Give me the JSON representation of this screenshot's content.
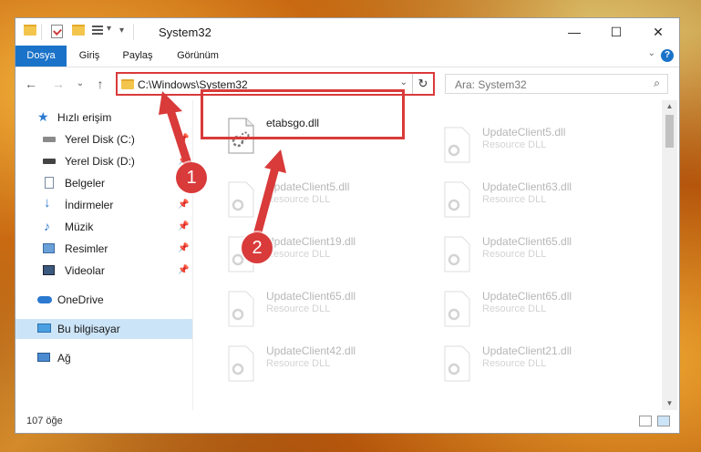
{
  "window": {
    "title": "System32",
    "minimize": "—",
    "maximize": "☐",
    "close": "✕"
  },
  "ribbon": {
    "tabs": [
      "Dosya",
      "Giriş",
      "Paylaş",
      "Görünüm"
    ],
    "help": "?"
  },
  "nav": {
    "back": "←",
    "forward": "→",
    "recent": "⌄",
    "up": "↑",
    "address": "C:\\Windows\\System32",
    "search_placeholder": "Ara: System32"
  },
  "sidebar": {
    "items": [
      {
        "label": "Hızlı erişim",
        "icon": "star-icon",
        "pinned": false
      },
      {
        "label": "Yerel Disk (C:)",
        "icon": "drive-icon",
        "pinned": true
      },
      {
        "label": "Yerel Disk (D:)",
        "icon": "drive-icon",
        "pinned": true
      },
      {
        "label": "Belgeler",
        "icon": "documents-icon",
        "pinned": true
      },
      {
        "label": "İndirmeler",
        "icon": "download-icon",
        "pinned": true
      },
      {
        "label": "Müzik",
        "icon": "music-icon",
        "pinned": true
      },
      {
        "label": "Resimler",
        "icon": "pictures-icon",
        "pinned": true
      },
      {
        "label": "Videolar",
        "icon": "videos-icon",
        "pinned": true
      },
      {
        "label": "OneDrive",
        "icon": "cloud-icon",
        "pinned": false
      },
      {
        "label": "Bu bilgisayar",
        "icon": "computer-icon",
        "pinned": false
      },
      {
        "label": "Ağ",
        "icon": "network-icon",
        "pinned": false
      }
    ]
  },
  "files": [
    {
      "name": "etabsgo.dll",
      "type": ""
    },
    {
      "name": "UpdateClient5.dll",
      "type": "Resource DLL"
    },
    {
      "name": "UpdateClient5.dll",
      "type": "Resource DLL"
    },
    {
      "name": "UpdateClient63.dll",
      "type": "Resource DLL"
    },
    {
      "name": "UpdateClient19.dll",
      "type": "Resource DLL"
    },
    {
      "name": "UpdateClient65.dll",
      "type": "Resource DLL"
    },
    {
      "name": "UpdateClient65.dll",
      "type": "Resource DLL"
    },
    {
      "name": "UpdateClient65.dll",
      "type": "Resource DLL"
    },
    {
      "name": "UpdateClient42.dll",
      "type": "Resource DLL"
    },
    {
      "name": "UpdateClient21.dll",
      "type": "Resource DLL"
    }
  ],
  "status": {
    "count": "107 öğe"
  },
  "annotations": {
    "step1": "1",
    "step2": "2",
    "color": "#d93a3a"
  }
}
